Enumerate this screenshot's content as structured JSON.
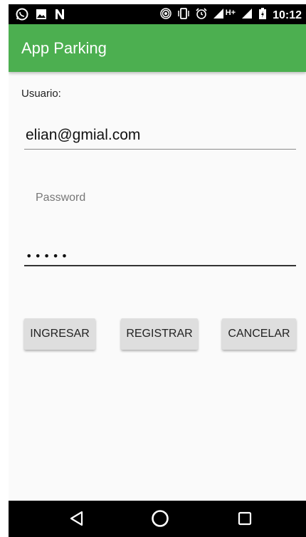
{
  "status_bar": {
    "icons": [
      "whatsapp-icon",
      "image-icon",
      "n-icon",
      "hotspot-icon",
      "vibrate-icon",
      "alarm-icon",
      "signal-icon",
      "signal-icon",
      "battery-icon"
    ],
    "network_type": "H+",
    "time": "10:12"
  },
  "app_bar": {
    "title": "App Parking",
    "color": "#4caf50"
  },
  "form": {
    "usuario_label": "Usuario:",
    "email_value": "elian@gmial.com",
    "password_label": "Password",
    "password_value": "•••••"
  },
  "buttons": {
    "ingresar": "INGRESAR",
    "registrar": "REGISTRAR",
    "cancelar": "CANCELAR"
  },
  "nav_bar": {
    "icons": [
      "back-icon",
      "home-icon",
      "recents-icon"
    ]
  }
}
